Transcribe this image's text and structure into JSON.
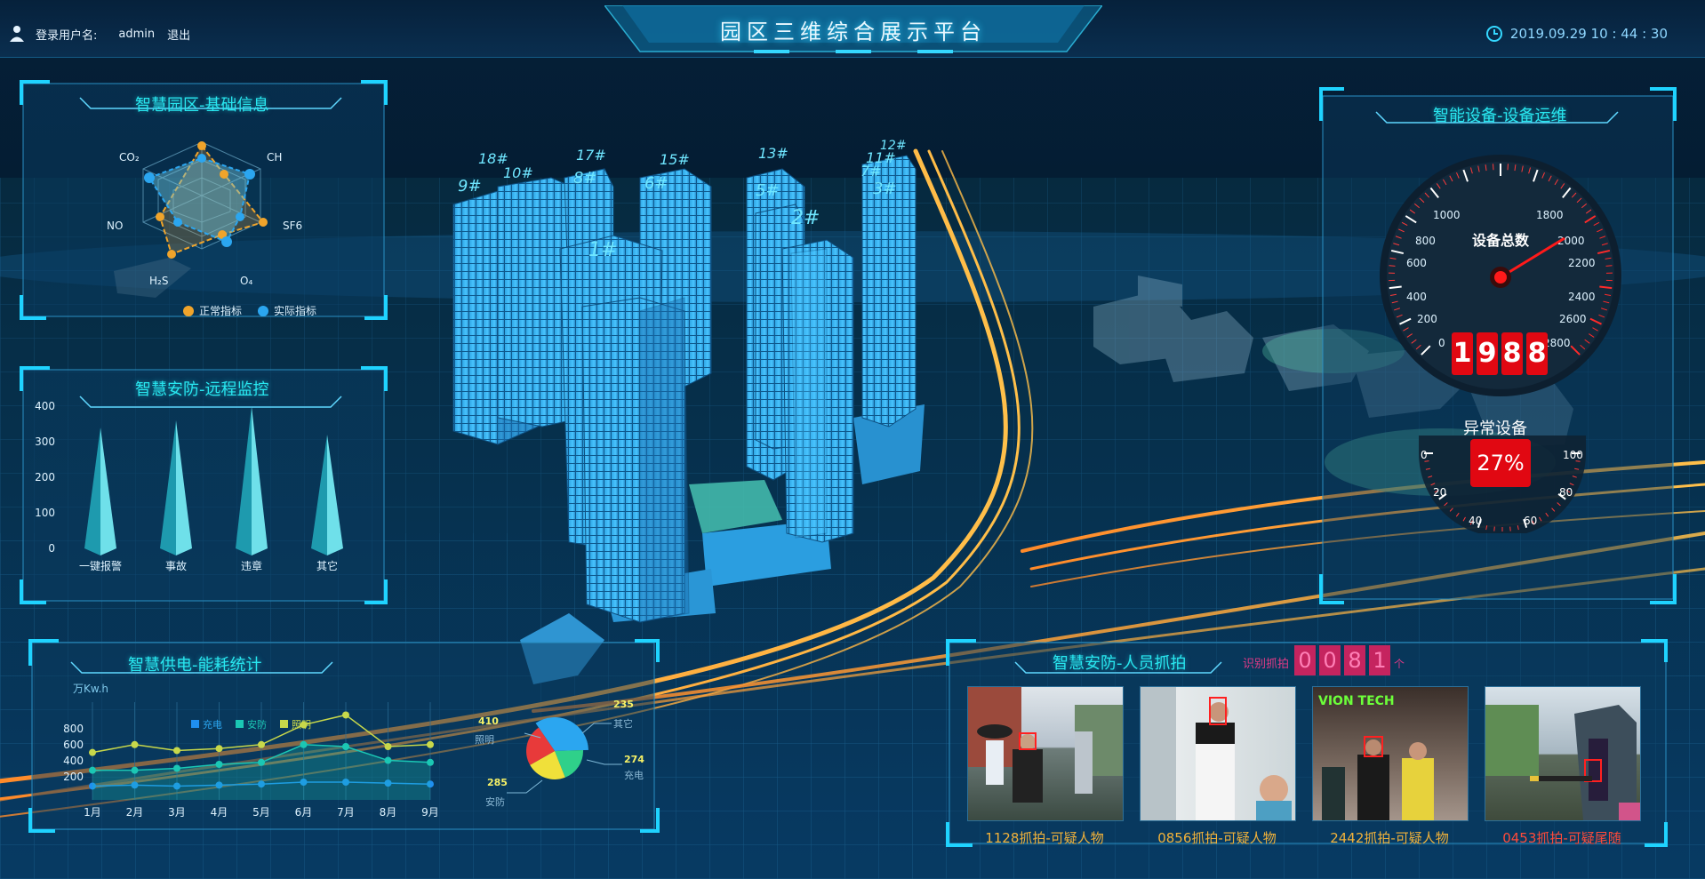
{
  "header": {
    "login_label": "登录用户名:",
    "username": "admin",
    "logout": "退出",
    "title": "园区三维综合展示平台",
    "datetime": "2019.09.29 10 : 44 : 30"
  },
  "panel_basic": {
    "title": "智慧园区-基础信息",
    "axes": [
      "CO₂",
      "CH",
      "SF6",
      "O₄",
      "H₂S",
      "NO"
    ],
    "legend": [
      "正常指标",
      "实际指标"
    ],
    "colors": {
      "normal": "#f0a42b",
      "actual": "#2ba6f0"
    }
  },
  "panel_security": {
    "title": "智慧安防-远程监控",
    "yticks": [
      "400",
      "300",
      "200",
      "100",
      "0"
    ],
    "categories": [
      "一键报警",
      "事故",
      "违章",
      "其它"
    ]
  },
  "panel_power": {
    "title": "智慧供电-能耗统计",
    "unit": "万Kw.h",
    "yticks": [
      "800",
      "600",
      "400",
      "200"
    ],
    "months": [
      "1月",
      "2月",
      "3月",
      "4月",
      "5月",
      "6月",
      "7月",
      "8月",
      "9月"
    ],
    "legend": [
      "充电",
      "安防",
      "照明"
    ],
    "pie_labels": [
      {
        "value": "410",
        "name": "照明"
      },
      {
        "value": "235",
        "name": "其它"
      },
      {
        "value": "274",
        "name": "充电"
      },
      {
        "value": "285",
        "name": "安防"
      }
    ]
  },
  "panel_capture": {
    "title": "智慧安防-人员抓拍",
    "counter_label": "识别抓拍",
    "counter_digits": [
      "0",
      "0",
      "8",
      "1"
    ],
    "counter_unit": "个",
    "captions": [
      "1128抓拍-可疑人物",
      "0856抓拍-可疑人物",
      "2442抓拍-可疑人物",
      "0453抓拍-可疑尾随"
    ],
    "sign_text": "VION TECH"
  },
  "panel_devices": {
    "title": "智能设备-设备运维",
    "gauge_label": "设备总数",
    "gauge_ticks": [
      "0",
      "200",
      "400",
      "600",
      "800",
      "1000",
      "1800",
      "2000",
      "2200",
      "2400",
      "2600",
      "2800"
    ],
    "odometer": [
      "1",
      "9",
      "8",
      "8"
    ],
    "abnormal_label": "异常设备",
    "abnormal_value": "27%",
    "small_ticks": [
      "0",
      "20",
      "40",
      "60",
      "80",
      "100"
    ]
  },
  "buildings": {
    "labels": [
      "18#",
      "10#",
      "9#",
      "17#",
      "8#",
      "15#",
      "6#",
      "1#",
      "13#",
      "5#",
      "2#",
      "12#",
      "11#",
      "7#",
      "3#"
    ]
  },
  "chart_data": [
    {
      "type": "line",
      "categories": [
        "1月",
        "2月",
        "3月",
        "4月",
        "5月",
        "6月",
        "7月",
        "8月",
        "9月"
      ],
      "series": [
        {
          "name": "充电",
          "values": [
            140,
            150,
            140,
            150,
            160,
            180,
            180,
            170,
            160
          ]
        },
        {
          "name": "安防",
          "values": [
            300,
            300,
            320,
            360,
            380,
            560,
            540,
            400,
            380
          ]
        },
        {
          "name": "照明",
          "values": [
            480,
            560,
            500,
            520,
            560,
            760,
            860,
            540,
            560
          ]
        }
      ],
      "ylabel": "万Kw.h",
      "ylim": [
        0,
        900
      ]
    },
    {
      "type": "pie",
      "categories": [
        "照明",
        "其它",
        "充电",
        "安防"
      ],
      "values": [
        410,
        235,
        274,
        285
      ]
    },
    {
      "type": "bar",
      "categories": [
        "一键报警",
        "事故",
        "违章",
        "其它"
      ],
      "values": [
        340,
        360,
        400,
        320
      ],
      "ylim": [
        0,
        400
      ]
    }
  ]
}
